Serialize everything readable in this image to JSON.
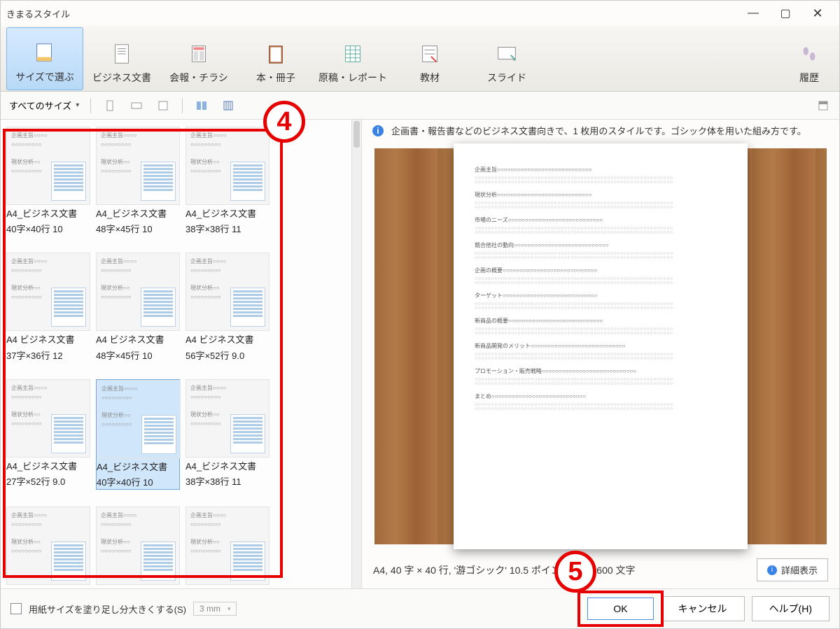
{
  "titlebar": {
    "title": "きまるスタイル"
  },
  "ribbon": {
    "items": [
      {
        "label": "サイズで選ぶ"
      },
      {
        "label": "ビジネス文書"
      },
      {
        "label": "会報・チラシ"
      },
      {
        "label": "本・冊子"
      },
      {
        "label": "原稿・レポート"
      },
      {
        "label": "教材"
      },
      {
        "label": "スライド"
      }
    ],
    "history": {
      "label": "履歴"
    }
  },
  "toolbar2": {
    "sizeFilter": "すべてのサイズ"
  },
  "gallery": {
    "thumbHeader1": "企画主旨○○○○",
    "thumbHeader2": "○○○○○○○○○",
    "thumbHeader3": "現状分析○○",
    "items": [
      {
        "line1": "A4_ビジネス文書",
        "line2": "40字×40行  10"
      },
      {
        "line1": "A4_ビジネス文書",
        "line2": "48字×45行  10"
      },
      {
        "line1": "A4_ビジネス文書",
        "line2": "38字×38行  11"
      },
      {
        "line1": "A4  ビジネス文書",
        "line2": "37字×36行  12"
      },
      {
        "line1": "A4  ビジネス文書",
        "line2": "48字×45行  10"
      },
      {
        "line1": "A4  ビジネス文書",
        "line2": "56字×52行  9.0"
      },
      {
        "line1": "A4_ビジネス文書",
        "line2": "27字×52行  9.0"
      },
      {
        "line1": "A4_ビジネス文書",
        "line2": "40字×40行  10"
      },
      {
        "line1": "A4_ビジネス文書",
        "line2": "38字×38行  11"
      },
      {
        "line1": "",
        "line2": ""
      },
      {
        "line1": "",
        "line2": ""
      },
      {
        "line1": "",
        "line2": ""
      }
    ]
  },
  "description": "企画書・報告書などのビジネス文書向きで、1 枚用のスタイルです。ゴシック体を用いた組み方です。",
  "preview": {
    "sections": [
      "企画主旨",
      "現状分析",
      "市場のニーズ",
      "競合他社の動向",
      "企画の概要",
      "ターゲット",
      "新商品の概要",
      "新商品開発のメリット",
      "プロモーション・販売戦略",
      "まとめ"
    ]
  },
  "infoRow": "A4,   40 字 × 40 行,   '游ゴシック' 10.5 ポイント,   約 1,600 文字",
  "detailBtn": "詳細表示",
  "footer": {
    "bleedLabel": "用紙サイズを塗り足し分大きくする(S)",
    "bleedValue": "3 mm",
    "ok": "OK",
    "cancel": "キャンセル",
    "help": "ヘルプ(H)"
  },
  "annotations": {
    "step4": "4",
    "step5": "5"
  }
}
